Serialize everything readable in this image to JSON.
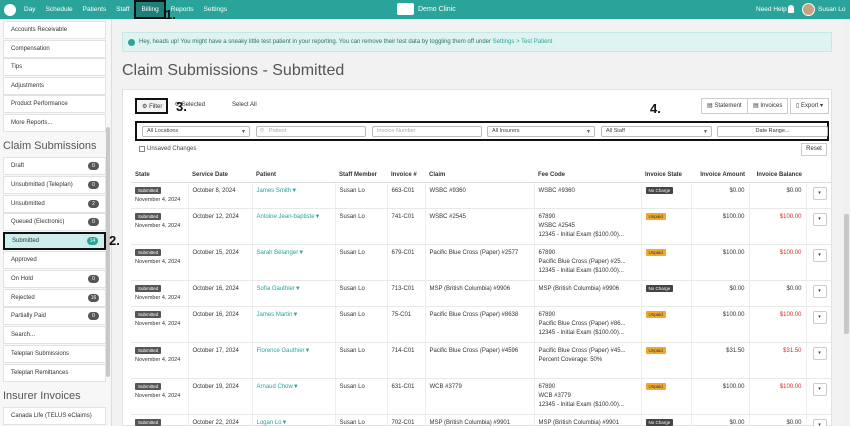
{
  "nav": {
    "items": [
      "Day",
      "Schedule",
      "Patients",
      "Staff",
      "Billing",
      "Reports",
      "Settings"
    ],
    "active": "Billing",
    "brand": "Demo Clinic",
    "help": "Need Help ?",
    "user": "Susan Lo"
  },
  "annotations": {
    "a1": "1.",
    "a2": "2.",
    "a3": "3.",
    "a4": "4."
  },
  "sidebar": {
    "billing_items": [
      "Accounts Receivable",
      "Compensation",
      "Tips",
      "Adjustments",
      "Product Performance",
      "More Reports..."
    ],
    "claims_heading": "Claim Submissions",
    "claims": [
      {
        "label": "Draft",
        "count": "0"
      },
      {
        "label": "Unsubmitted (Teleplan)",
        "count": "0"
      },
      {
        "label": "Unsubmitted",
        "count": "2"
      },
      {
        "label": "Queued (Electronic)",
        "count": "0"
      },
      {
        "label": "Submitted",
        "count": "14"
      },
      {
        "label": "Approved",
        "count": ""
      },
      {
        "label": "On Hold",
        "count": "0"
      },
      {
        "label": "Rejected",
        "count": "16"
      },
      {
        "label": "Partially Paid",
        "count": "0"
      },
      {
        "label": "Search...",
        "count": ""
      },
      {
        "label": "Teleplan Submissions",
        "count": ""
      },
      {
        "label": "Teleplan Remittances",
        "count": ""
      }
    ],
    "insurer_heading": "Insurer Invoices",
    "insurers": [
      "Canada Life (TELUS eClaims)"
    ]
  },
  "banner": {
    "text": "Hey, heads up! You might have a sneaky little test patient in your reporting. You can remove their test data by toggling them off under ",
    "link": "Settings > Test Patient"
  },
  "page_title": "Claim Submissions - Submitted",
  "toolbar": {
    "filter": "Filter",
    "selected": "Selected",
    "select_all": "Select All",
    "statement": "Statement",
    "invoices": "Invoices",
    "export": "Export"
  },
  "filters": {
    "locations": "All Locations",
    "patient_ph": "Patient",
    "invoice_ph": "Invoice Number",
    "insurers": "All Insurers",
    "staff": "All Staff",
    "date_range": "Date Range..."
  },
  "unsaved": "Unsaved Changes",
  "reset": "Reset",
  "table": {
    "headers": [
      "State",
      "Service Date",
      "Patient",
      "Staff Member",
      "Invoice #",
      "Claim",
      "Fee Code",
      "Invoice State",
      "Invoice Amount",
      "Invoice Balance"
    ],
    "rows": [
      {
        "state": "Submitted",
        "sub_date": "November 4, 2024",
        "service_date": "October 8, 2024",
        "patient": "James Smith",
        "staff": "Susan Lo",
        "invoice": "663-C01",
        "claim": "WSBC #9360",
        "fee": [
          "WSBC #9360"
        ],
        "inv_state": "No Charge",
        "amount": "$0.00",
        "balance": "$0.00",
        "balance_red": false
      },
      {
        "state": "Submitted",
        "sub_date": "November 4, 2024",
        "service_date": "October 12, 2024",
        "patient": "Antoine Jean-baptiste",
        "staff": "Susan Lo",
        "invoice": "741-C01",
        "claim": "WSBC #2545",
        "fee": [
          "67890",
          "WSBC #2545",
          "12345 - Initial Exam ($100.00)..."
        ],
        "inv_state": "Unpaid",
        "amount": "$100.00",
        "balance": "$100.00",
        "balance_red": true
      },
      {
        "state": "Submitted",
        "sub_date": "November 4, 2024",
        "service_date": "October 15, 2024",
        "patient": "Sarah Bélanger",
        "staff": "Susan Lo",
        "invoice": "679-C01",
        "claim": "Pacific Blue Cross (Paper) #2577",
        "fee": [
          "67890",
          "Pacific Blue Cross (Paper) #25...",
          "12345 - Initial Exam ($100.00)..."
        ],
        "inv_state": "Unpaid",
        "amount": "$100.00",
        "balance": "$100.00",
        "balance_red": true
      },
      {
        "state": "Submitted",
        "sub_date": "November 4, 2024",
        "service_date": "October 16, 2024",
        "patient": "Sofia Gauthier",
        "staff": "Susan Lo",
        "invoice": "713-C01",
        "claim": "MSP (British Columbia) #9906",
        "fee": [
          "MSP (British Columbia) #9906"
        ],
        "inv_state": "No Charge",
        "amount": "$0.00",
        "balance": "$0.00",
        "balance_red": false
      },
      {
        "state": "Submitted",
        "sub_date": "November 4, 2024",
        "service_date": "October 16, 2024",
        "patient": "James Martin",
        "staff": "Susan Lo",
        "invoice": "75-C01",
        "claim": "Pacific Blue Cross (Paper) #8638",
        "fee": [
          "67890",
          "Pacific Blue Cross (Paper) #86...",
          "12345 - Initial Exam ($100.00)..."
        ],
        "inv_state": "Unpaid",
        "amount": "$100.00",
        "balance": "$100.00",
        "balance_red": true
      },
      {
        "state": "Submitted",
        "sub_date": "November 4, 2024",
        "service_date": "October 17, 2024",
        "patient": "Florence Gauthier",
        "staff": "Susan Lo",
        "invoice": "714-C01",
        "claim": "Pacific Blue Cross (Paper) #4596",
        "fee": [
          "Pacific Blue Cross (Paper) #45...",
          "Percent Coverage: 50%"
        ],
        "inv_state": "Unpaid",
        "amount": "$31.50",
        "balance": "$31.50",
        "balance_red": true
      },
      {
        "state": "Submitted",
        "sub_date": "November 4, 2024",
        "service_date": "October 19, 2024",
        "patient": "Arnaud Chow",
        "staff": "Susan Lo",
        "invoice": "631-C01",
        "claim": "WCB #3779",
        "fee": [
          "67890",
          "WCB #3779",
          "12345 - Initial Exam ($100.00)..."
        ],
        "inv_state": "Unpaid",
        "amount": "$100.00",
        "balance": "$100.00",
        "balance_red": true
      },
      {
        "state": "Submitted",
        "sub_date": "November 4, 2024",
        "service_date": "October 22, 2024",
        "patient": "Logan Lo",
        "staff": "Susan Lo",
        "invoice": "702-C01",
        "claim": "MSP (British Columbia) #9901",
        "fee": [
          "MSP (British Columbia) #9901"
        ],
        "inv_state": "No Charge",
        "amount": "$0.00",
        "balance": "$0.00",
        "balance_red": false
      }
    ]
  },
  "colors": {
    "brand": "#2aa49a",
    "unpaid": "#f0a92c",
    "no_charge": "#444444",
    "balance_red": "#c9302c"
  }
}
